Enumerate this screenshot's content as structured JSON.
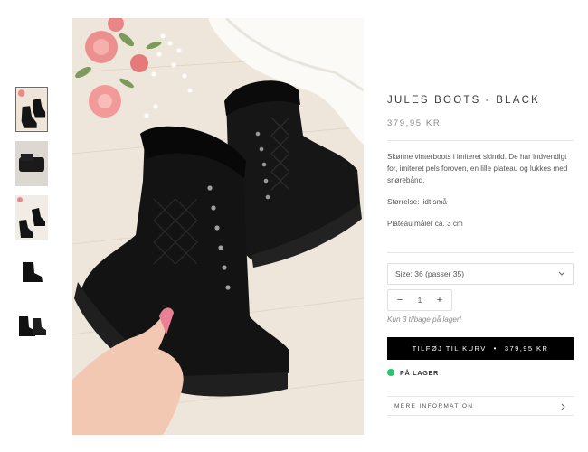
{
  "thumbnails": [
    {
      "name": "thumb-1",
      "active": true
    },
    {
      "name": "thumb-2",
      "active": false
    },
    {
      "name": "thumb-3",
      "active": false
    },
    {
      "name": "thumb-4",
      "active": false
    },
    {
      "name": "thumb-5",
      "active": false
    }
  ],
  "product": {
    "title": "JULES BOOTS - BLACK",
    "price": "379,95 KR",
    "description": [
      "Skønne vinterboots i imiteret skindd. De har indvendigt for, imiteret pels foroven, en lille plateau og lukkes med snørebånd.",
      "Størrelse: lidt små",
      "Plateau måler ca. 3 cm"
    ]
  },
  "size_select": {
    "value": "Size: 36 (passer 35)",
    "icon": "chevron-down-icon"
  },
  "quantity": {
    "minus": "−",
    "value": "1",
    "plus": "+"
  },
  "stock_note": "Kun 3 tilbage på lager!",
  "add_to_cart": {
    "label": "TILFØJ TIL KURV",
    "separator": "•",
    "price": "379,95 KR"
  },
  "availability": {
    "label": "PÅ LAGER",
    "color": "#27c46b"
  },
  "more_info": {
    "label": "MERE INFORMATION",
    "icon": "chevron-right-icon"
  },
  "colors": {
    "button_bg": "#000000",
    "button_text": "#ffffff",
    "accent_green": "#27c46b"
  }
}
